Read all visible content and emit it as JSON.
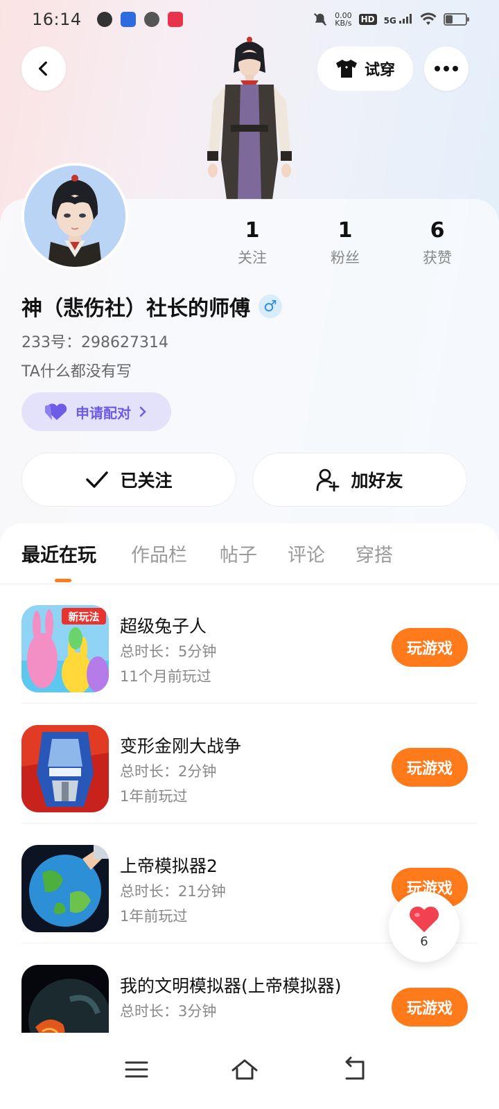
{
  "status_bar": {
    "time": "16:14",
    "net_speed_value": "0.00",
    "net_speed_unit": "KB/s",
    "hd_badge": "HD",
    "signal_label": "5G"
  },
  "top_bar": {
    "tryon_label": "试穿"
  },
  "profile": {
    "stats": [
      {
        "value": "1",
        "label": "关注"
      },
      {
        "value": "1",
        "label": "粉丝"
      },
      {
        "value": "6",
        "label": "获赞"
      }
    ],
    "username": "神（悲伤社）社长的师傅",
    "gender_symbol": "♂",
    "uid": "233号：298627314",
    "bio": "TA什么都没有写",
    "pair_label": "申请配对",
    "follow_label": "已关注",
    "add_friend_label": "加好友"
  },
  "tabs": [
    {
      "label": "最近在玩",
      "active": true
    },
    {
      "label": "作品栏",
      "active": false
    },
    {
      "label": "帖子",
      "active": false
    },
    {
      "label": "评论",
      "active": false
    },
    {
      "label": "穿搭",
      "active": false
    }
  ],
  "games": [
    {
      "title": "超级兔子人",
      "duration": "总时长：5分钟",
      "last_played": "11个月前玩过",
      "button": "玩游戏",
      "icon_badge": "新玩法"
    },
    {
      "title": "变形金刚大战争",
      "duration": "总时长：2分钟",
      "last_played": "1年前玩过",
      "button": "玩游戏"
    },
    {
      "title": "上帝模拟器2",
      "duration": "总时长：21分钟",
      "last_played": "1年前玩过",
      "button": "玩游戏"
    },
    {
      "title": "我的文明模拟器(上帝模拟器)",
      "duration": "总时长：3分钟",
      "last_played": "",
      "button": "玩游戏"
    }
  ],
  "like_float": {
    "count": "6"
  },
  "colors": {
    "accent_orange": "#ff7a1a",
    "pair_purple": "#6d5ce6",
    "like_red": "#f2414f"
  }
}
